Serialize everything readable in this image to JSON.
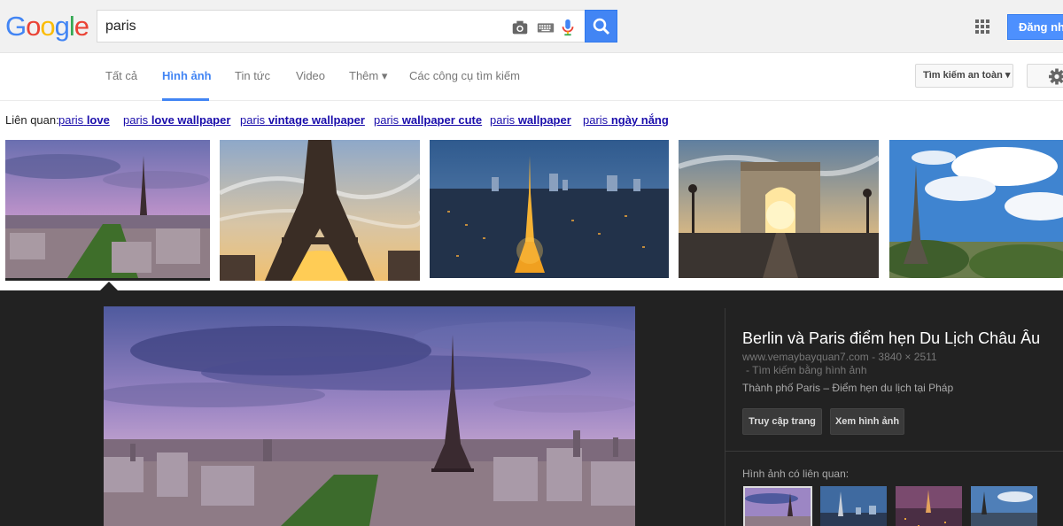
{
  "search": {
    "query": "paris"
  },
  "header": {
    "signin_label": "Đăng nhập"
  },
  "nav": {
    "tabs": [
      {
        "label": "Tất cả"
      },
      {
        "label": "Hình ảnh"
      },
      {
        "label": "Tin tức"
      },
      {
        "label": "Video"
      },
      {
        "label": "Thêm ▾"
      },
      {
        "label": "Các công cụ tìm kiếm"
      }
    ],
    "safesearch_label": "Tìm kiếm an toàn ▾"
  },
  "related": {
    "label": "Liên quan:",
    "links": [
      {
        "prefix": "paris",
        "bold": "love"
      },
      {
        "prefix": "paris",
        "bold": "love wallpaper"
      },
      {
        "prefix": "paris",
        "bold": "vintage wallpaper"
      },
      {
        "prefix": "paris",
        "bold": "wallpaper cute"
      },
      {
        "prefix": "paris",
        "bold": "wallpaper"
      },
      {
        "prefix": "paris",
        "bold": "ngày nắng"
      }
    ]
  },
  "preview": {
    "title": "Berlin và Paris điểm hẹn Du Lịch Châu Âu",
    "source": "www.vemaybayquan7.com - 3840 × 2511",
    "reverse_search": "- Tìm kiếm bằng hình ảnh",
    "description": "Thành phố Paris – Điểm hẹn du lịch tại Pháp",
    "visit_button": "Truy cập trang",
    "view_button": "Xem hình ảnh",
    "related_images_label": "Hình ảnh có liên quan:"
  }
}
